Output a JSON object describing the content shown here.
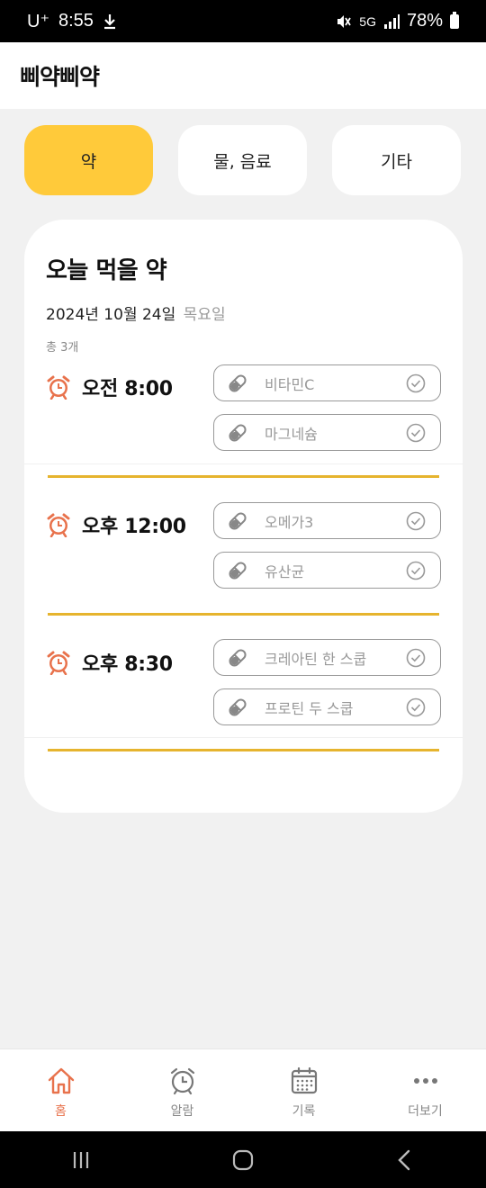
{
  "status_bar": {
    "carrier": "U⁺",
    "time": "8:55",
    "download_icon": "download-icon",
    "network": "5G",
    "battery": "78%"
  },
  "header": {
    "title": "삐약삐약"
  },
  "tabs": [
    {
      "label": "약",
      "active": true
    },
    {
      "label": "물, 음료",
      "active": false
    },
    {
      "label": "기타",
      "active": false
    }
  ],
  "card": {
    "title": "오늘 먹을 약",
    "date": "2024년 10월 24일",
    "weekday": "목요일",
    "count": "총 3개",
    "slots": [
      {
        "time": "오전 8:00",
        "items": [
          "비타민C",
          "마그네슘"
        ]
      },
      {
        "time": "오후 12:00",
        "items": [
          "오메가3",
          "유산균"
        ]
      },
      {
        "time": "오후 8:30",
        "items": [
          "크레아틴 한 스쿱",
          "프로틴 두 스쿱"
        ]
      }
    ]
  },
  "bottom_nav": [
    {
      "label": "홈",
      "icon": "home-icon",
      "active": true
    },
    {
      "label": "알람",
      "icon": "alarm-clock-icon",
      "active": false
    },
    {
      "label": "기록",
      "icon": "calendar-icon",
      "active": false
    },
    {
      "label": "더보기",
      "icon": "more-dots-icon",
      "active": false
    }
  ],
  "colors": {
    "accent_yellow": "#ffca3a",
    "divider_yellow": "#e6b42e",
    "alarm_orange": "#e8724c",
    "home_active": "#e8724c"
  }
}
